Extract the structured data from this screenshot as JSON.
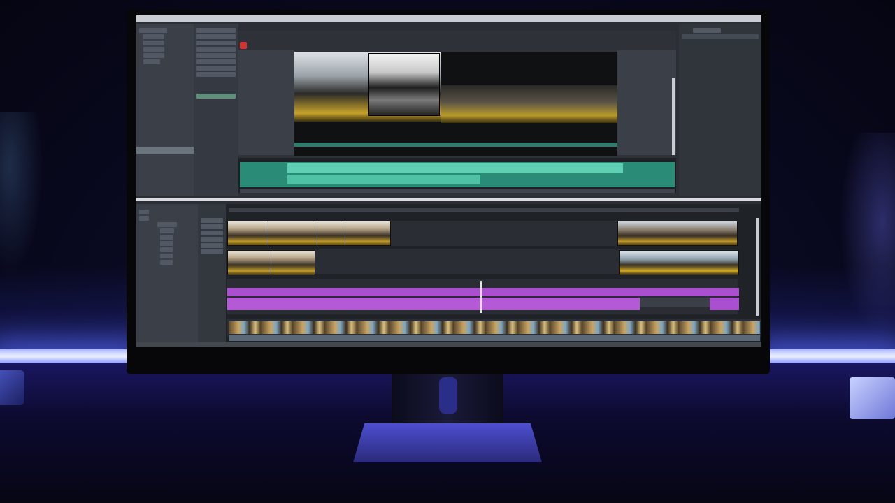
{
  "app": {
    "menu_items": [
      "",
      "",
      "",
      "",
      "",
      ""
    ],
    "colors": {
      "background": "#24272c",
      "panel": "#3a3f48",
      "audio_track": "#31a98f",
      "video_track_2": "#a94fcf",
      "record_button": "#d43333"
    }
  },
  "viewer": {
    "playhead_position": 0.5
  },
  "timeline": {
    "tracks": [
      "video-1",
      "video-2",
      "audio-1",
      "video-3"
    ]
  }
}
